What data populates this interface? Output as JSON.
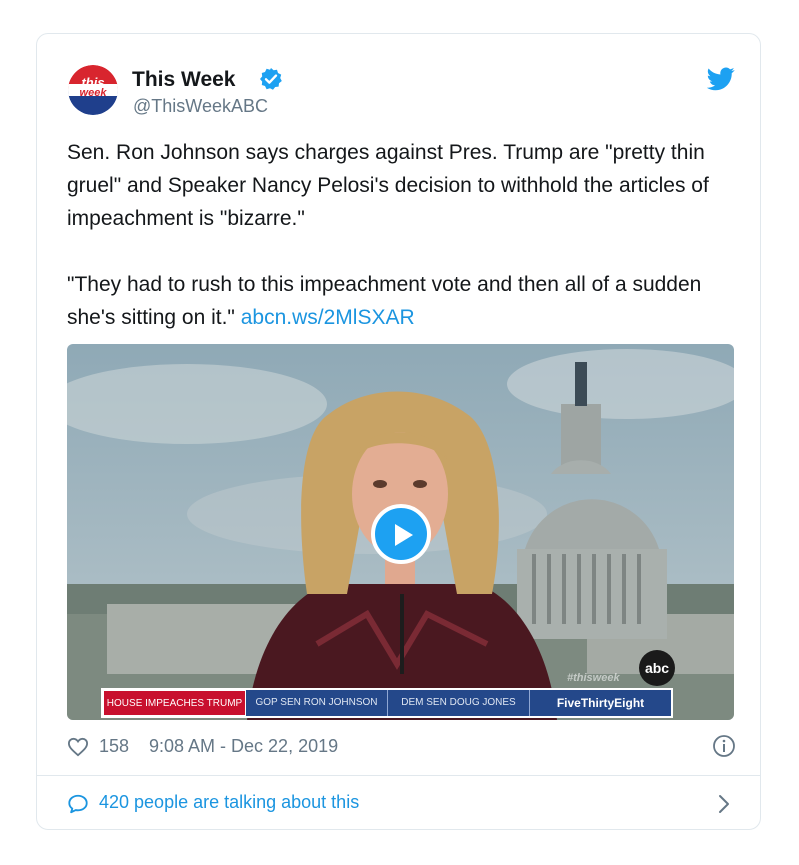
{
  "author": {
    "name": "This Week",
    "handle": "@ThisWeekABC",
    "avatar_text_top": "this",
    "avatar_text_bottom": "week",
    "verified_icon": "verified-badge-icon"
  },
  "tweet": {
    "paragraph1": "Sen. Ron Johnson says charges against Pres. Trump are \"pretty thin gruel\" and Speaker Nancy Pelosi's decision to withhold the articles of impeachment is \"bizarre.\"",
    "paragraph2": "\"They had to rush to this impeachment vote and then all of a sudden she's sitting on it.\"",
    "link": "abcn.ws/2MlSXAR"
  },
  "media": {
    "watermark": "#thisweek",
    "network_logo": "abc",
    "lower_third": [
      "HOUSE IMPEACHES TRUMP",
      "GOP SEN RON JOHNSON",
      "DEM SEN DOUG JONES",
      "FiveThirtyEight"
    ]
  },
  "footer": {
    "like_count": "158",
    "timestamp": "9:08 AM - Dec 22, 2019",
    "talk_text": "420 people are talking about this"
  },
  "colors": {
    "link": "#1b95e0",
    "twitter_blue": "#1da1f2",
    "meta_gray": "#657786"
  }
}
